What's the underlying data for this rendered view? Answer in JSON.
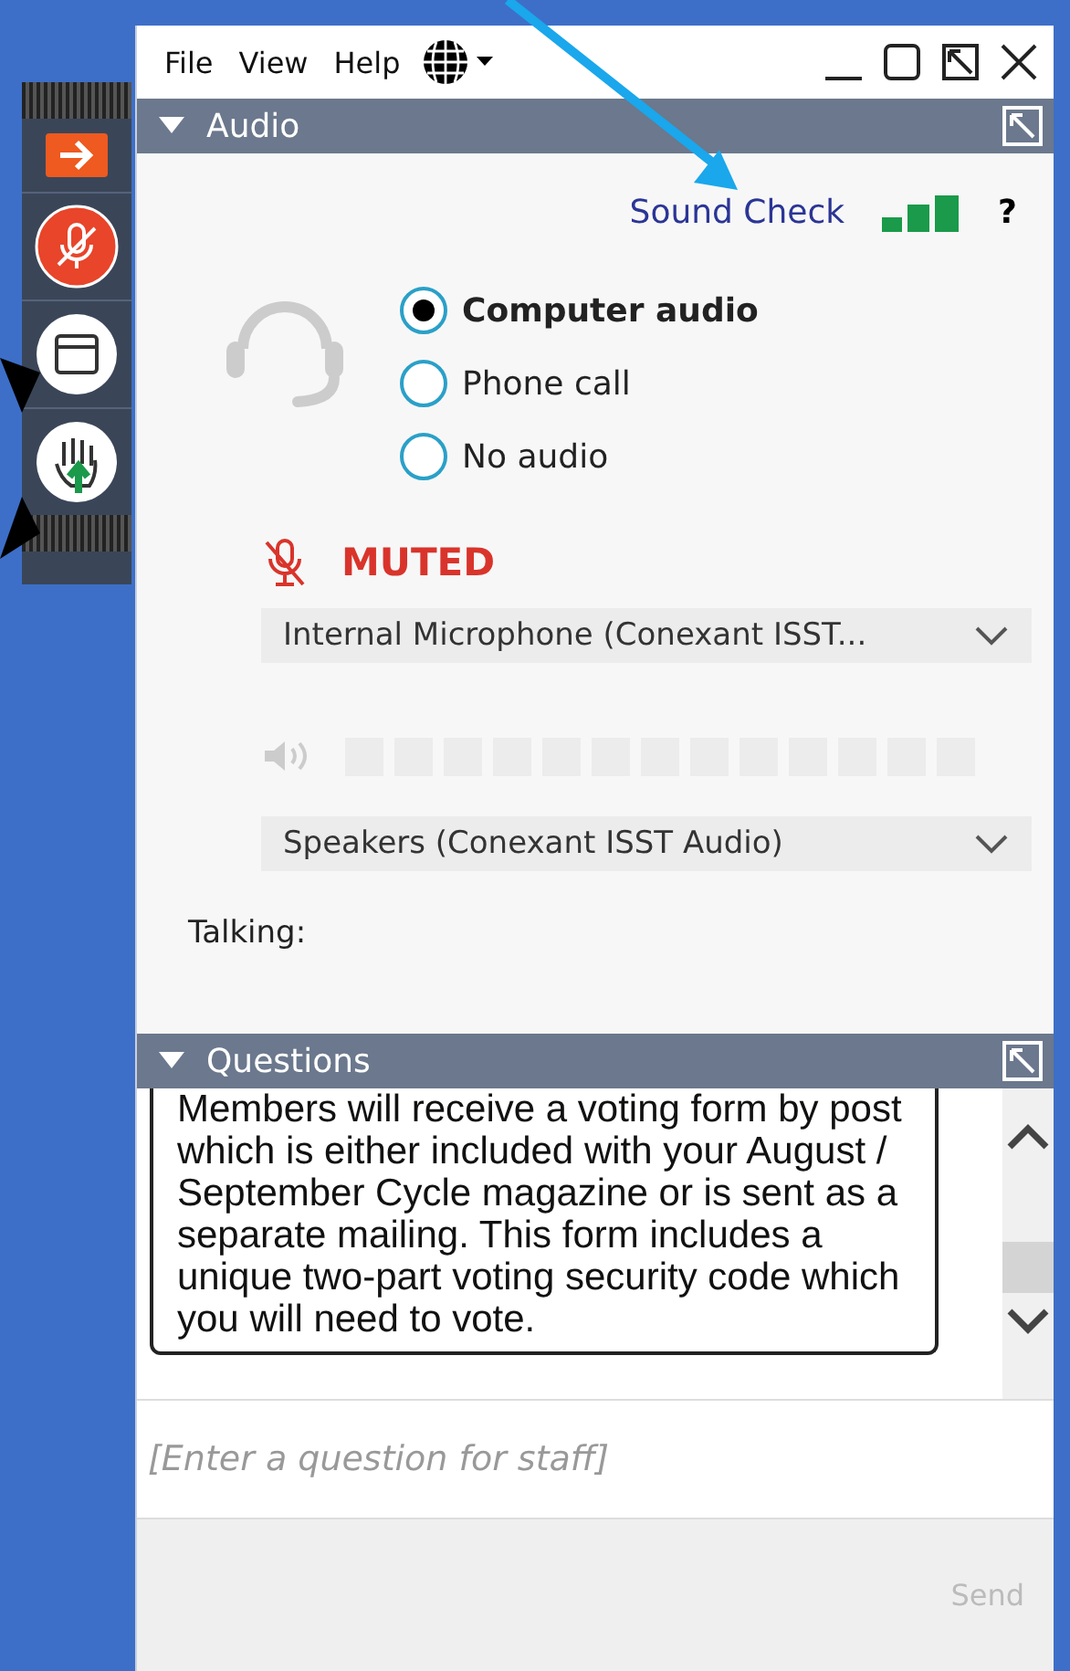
{
  "menu": [
    "File",
    "View",
    "Help"
  ],
  "audio": {
    "title": "Audio",
    "sound_check": "Sound Check",
    "help": "?",
    "options": [
      {
        "label": "Computer audio",
        "selected": true
      },
      {
        "label": "Phone call",
        "selected": false
      },
      {
        "label": "No audio",
        "selected": false
      }
    ],
    "muted": true,
    "muted_label": "MUTED",
    "microphone": "Internal Microphone (Conexant ISST...",
    "speakers": "Speakers (Conexant ISST Audio)",
    "talking": "Talking:"
  },
  "questions": {
    "title": "Questions",
    "message": "Members will receive a voting form by post which is either included with your August / September Cycle magazine or is sent as a separate mailing. This form includes a unique two-part voting security code which you will need to vote.",
    "placeholder": "[Enter a question for staff]",
    "send": {
      "label": "Send",
      "disabled": true
    }
  }
}
